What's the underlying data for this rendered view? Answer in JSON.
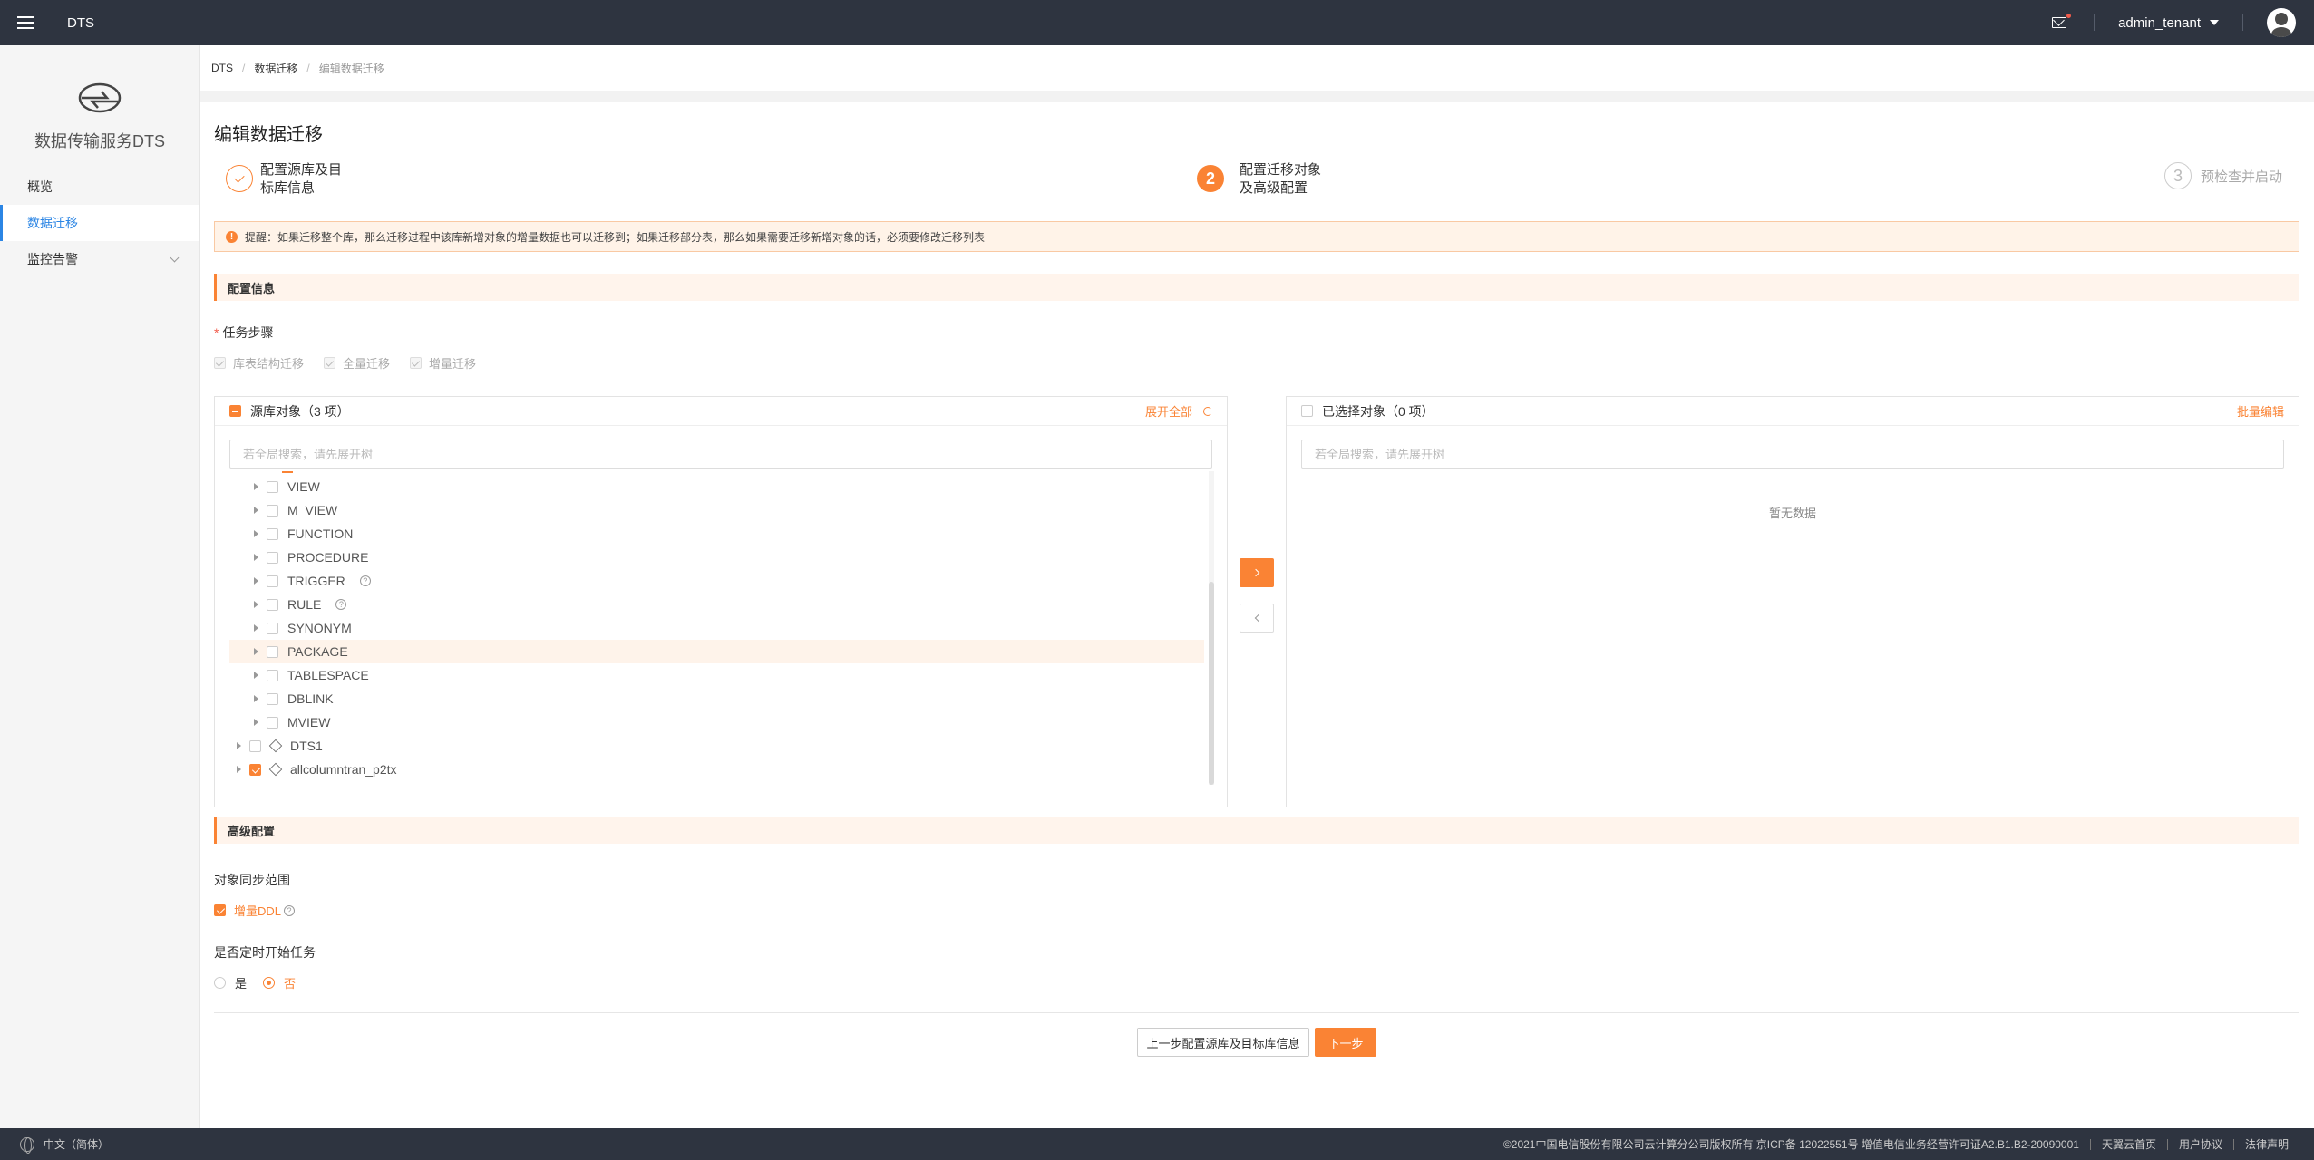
{
  "topbar": {
    "title": "DTS",
    "user": "admin_tenant"
  },
  "sidebar": {
    "brand": "数据传输服务DTS",
    "items": [
      {
        "label": "概览"
      },
      {
        "label": "数据迁移"
      },
      {
        "label": "监控告警"
      }
    ]
  },
  "breadcrumb": {
    "items": [
      "DTS",
      "数据迁移",
      "编辑数据迁移"
    ]
  },
  "page": {
    "title": "编辑数据迁移"
  },
  "steps": [
    {
      "line1": "配置源库及目",
      "line2": "标库信息"
    },
    {
      "number": "2",
      "line1": "配置迁移对象",
      "line2": "及高级配置"
    },
    {
      "number": "3",
      "label": "预检查并启动"
    }
  ],
  "alert": "提醒：如果迁移整个库，那么迁移过程中该库新增对象的增量数据也可以迁移到；如果迁移部分表，那么如果需要迁移新增对象的话，必须要修改迁移列表",
  "config": {
    "section_title": "配置信息",
    "task_steps_label": "任务步骤",
    "task_steps": [
      "库表结构迁移",
      "全量迁移",
      "增量迁移"
    ]
  },
  "source_panel": {
    "title": "源库对象（3 项）",
    "expand_all": "展开全部",
    "search_placeholder": "若全局搜索，请先展开树",
    "tree": [
      {
        "label": "VIEW"
      },
      {
        "label": "M_VIEW"
      },
      {
        "label": "FUNCTION"
      },
      {
        "label": "PROCEDURE"
      },
      {
        "label": "TRIGGER"
      },
      {
        "label": "RULE"
      },
      {
        "label": "SYNONYM"
      },
      {
        "label": "PACKAGE"
      },
      {
        "label": "TABLESPACE"
      },
      {
        "label": "DBLINK"
      },
      {
        "label": "MVIEW"
      },
      {
        "label": "DTS1"
      },
      {
        "label": "allcolumntran_p2tx"
      }
    ]
  },
  "target_panel": {
    "title": "已选择对象（0 项）",
    "batch_edit": "批量编辑",
    "search_placeholder": "若全局搜索，请先展开树",
    "empty": "暂无数据"
  },
  "advanced": {
    "section_title": "高级配置",
    "sync_scope_label": "对象同步范围",
    "incremental_ddl": "增量DDL",
    "schedule_label": "是否定时开始任务",
    "yes": "是",
    "no": "否"
  },
  "buttons": {
    "prev": "上一步配置源库及目标库信息",
    "next": "下一步"
  },
  "footer": {
    "language": "中文（简体）",
    "copyright": "©2021中国电信股份有限公司云计算分公司版权所有 京ICP备 12022551号 增值电信业务经营许可证A2.B1.B2-20090001",
    "links": [
      "天翼云首页",
      "用户协议",
      "法律声明"
    ]
  },
  "colors": {
    "accent": "#fa8334",
    "nav_active": "#2b85e4",
    "topbar": "#2e3440"
  }
}
